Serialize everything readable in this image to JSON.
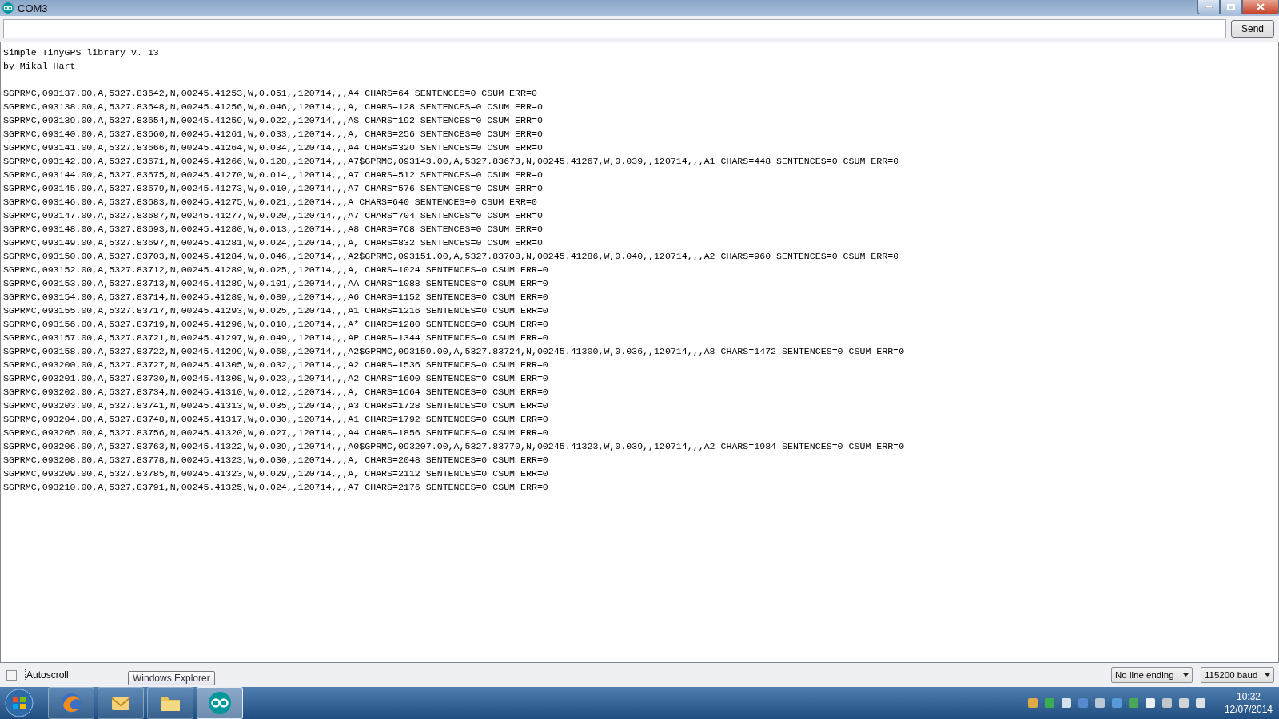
{
  "window": {
    "title": "COM3"
  },
  "send_button": "Send",
  "output": {
    "header": [
      "Simple TinyGPS library v. 13",
      "by Mikal Hart"
    ],
    "sentences": [
      "$GPRMC,093137.00,A,5327.83642,N,00245.41253,W,0.051,,120714,,,A4 CHARS=64 SENTENCES=0 CSUM ERR=0",
      "$GPRMC,093138.00,A,5327.83648,N,00245.41256,W,0.046,,120714,,,A, CHARS=128 SENTENCES=0 CSUM ERR=0",
      "$GPRMC,093139.00,A,5327.83654,N,00245.41259,W,0.022,,120714,,,AS CHARS=192 SENTENCES=0 CSUM ERR=0",
      "$GPRMC,093140.00,A,5327.83660,N,00245.41261,W,0.033,,120714,,,A, CHARS=256 SENTENCES=0 CSUM ERR=0",
      "$GPRMC,093141.00,A,5327.83666,N,00245.41264,W,0.034,,120714,,,A4 CHARS=320 SENTENCES=0 CSUM ERR=0",
      "$GPRMC,093142.00,A,5327.83671,N,00245.41266,W,0.128,,120714,,,A7$GPRMC,093143.00,A,5327.83673,N,00245.41267,W,0.039,,120714,,,A1 CHARS=448 SENTENCES=0 CSUM ERR=0",
      "$GPRMC,093144.00,A,5327.83675,N,00245.41270,W,0.014,,120714,,,A7 CHARS=512 SENTENCES=0 CSUM ERR=0",
      "$GPRMC,093145.00,A,5327.83679,N,00245.41273,W,0.010,,120714,,,A7 CHARS=576 SENTENCES=0 CSUM ERR=0",
      "$GPRMC,093146.00,A,5327.83683,N,00245.41275,W,0.021,,120714,,,A CHARS=640 SENTENCES=0 CSUM ERR=0",
      "$GPRMC,093147.00,A,5327.83687,N,00245.41277,W,0.020,,120714,,,A7 CHARS=704 SENTENCES=0 CSUM ERR=0",
      "$GPRMC,093148.00,A,5327.83693,N,00245.41280,W,0.013,,120714,,,A8 CHARS=768 SENTENCES=0 CSUM ERR=0",
      "$GPRMC,093149.00,A,5327.83697,N,00245.41281,W,0.024,,120714,,,A, CHARS=832 SENTENCES=0 CSUM ERR=0",
      "$GPRMC,093150.00,A,5327.83703,N,00245.41284,W,0.046,,120714,,,A2$GPRMC,093151.00,A,5327.83708,N,00245.41286,W,0.040,,120714,,,A2 CHARS=960 SENTENCES=0 CSUM ERR=0",
      "$GPRMC,093152.00,A,5327.83712,N,00245.41289,W,0.025,,120714,,,A, CHARS=1024 SENTENCES=0 CSUM ERR=0",
      "$GPRMC,093153.00,A,5327.83713,N,00245.41289,W,0.101,,120714,,,AA CHARS=1088 SENTENCES=0 CSUM ERR=0",
      "$GPRMC,093154.00,A,5327.83714,N,00245.41289,W,0.089,,120714,,,A6 CHARS=1152 SENTENCES=0 CSUM ERR=0",
      "$GPRMC,093155.00,A,5327.83717,N,00245.41293,W,0.025,,120714,,,A1 CHARS=1216 SENTENCES=0 CSUM ERR=0",
      "$GPRMC,093156.00,A,5327.83719,N,00245.41296,W,0.010,,120714,,,A* CHARS=1280 SENTENCES=0 CSUM ERR=0",
      "$GPRMC,093157.00,A,5327.83721,N,00245.41297,W,0.049,,120714,,,AP CHARS=1344 SENTENCES=0 CSUM ERR=0",
      "$GPRMC,093158.00,A,5327.83722,N,00245.41299,W,0.068,,120714,,,A2$GPRMC,093159.00,A,5327.83724,N,00245.41300,W,0.036,,120714,,,A8 CHARS=1472 SENTENCES=0 CSUM ERR=0",
      "$GPRMC,093200.00,A,5327.83727,N,00245.41305,W,0.032,,120714,,,A2 CHARS=1536 SENTENCES=0 CSUM ERR=0",
      "$GPRMC,093201.00,A,5327.83730,N,00245.41308,W,0.023,,120714,,,A2 CHARS=1600 SENTENCES=0 CSUM ERR=0",
      "$GPRMC,093202.00,A,5327.83734,N,00245.41310,W,0.012,,120714,,,A, CHARS=1664 SENTENCES=0 CSUM ERR=0",
      "$GPRMC,093203.00,A,5327.83741,N,00245.41313,W,0.035,,120714,,,A3 CHARS=1728 SENTENCES=0 CSUM ERR=0",
      "$GPRMC,093204.00,A,5327.83748,N,00245.41317,W,0.030,,120714,,,A1 CHARS=1792 SENTENCES=0 CSUM ERR=0",
      "$GPRMC,093205.00,A,5327.83756,N,00245.41320,W,0.027,,120714,,,A4 CHARS=1856 SENTENCES=0 CSUM ERR=0",
      "$GPRMC,093206.00,A,5327.83763,N,00245.41322,W,0.039,,120714,,,A0$GPRMC,093207.00,A,5327.83770,N,00245.41323,W,0.039,,120714,,,A2 CHARS=1984 SENTENCES=0 CSUM ERR=0",
      "$GPRMC,093208.00,A,5327.83778,N,00245.41323,W,0.030,,120714,,,A, CHARS=2048 SENTENCES=0 CSUM ERR=0",
      "$GPRMC,093209.00,A,5327.83785,N,00245.41323,W,0.029,,120714,,,A, CHARS=2112 SENTENCES=0 CSUM ERR=0",
      "$GPRMC,093210.00,A,5327.83791,N,00245.41325,W,0.024,,120714,,,A7 CHARS=2176 SENTENCES=0 CSUM ERR=0"
    ]
  },
  "autoscroll": {
    "label": "Autoscroll",
    "checked": false
  },
  "line_ending": "No line ending",
  "baud": "115200 baud",
  "tooltip": "Windows Explorer",
  "taskbar": {
    "apps": [
      {
        "kind": "browser",
        "selected": false
      },
      {
        "kind": "mail",
        "selected": false
      },
      {
        "kind": "folder",
        "selected": false
      },
      {
        "kind": "arduino",
        "selected": true
      }
    ],
    "time": "10:32",
    "date": "12/07/2014"
  }
}
